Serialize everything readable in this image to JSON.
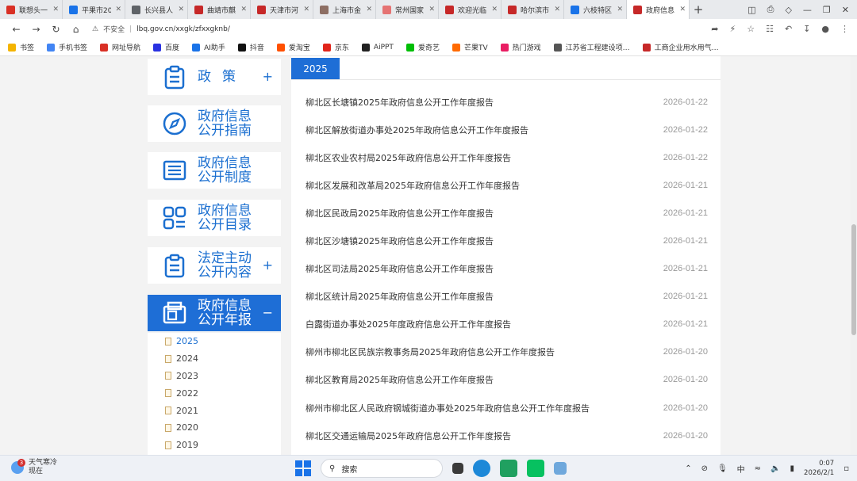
{
  "browser": {
    "tabs": [
      {
        "title": "联想头一…",
        "color": "#d93025"
      },
      {
        "title": "平果市20…",
        "color": "#1a73e8"
      },
      {
        "title": "长兴县人…",
        "color": "#5f6368"
      },
      {
        "title": "曲靖市麒…",
        "color": "#c62828"
      },
      {
        "title": "天津市河…",
        "color": "#c62828"
      },
      {
        "title": "上海市金…",
        "color": "#8d6e63"
      },
      {
        "title": "常州国家…",
        "color": "#e57373"
      },
      {
        "title": "欢迎光临…",
        "color": "#c62828"
      },
      {
        "title": "哈尔滨市…",
        "color": "#c62828"
      },
      {
        "title": "六枝特区…",
        "color": "#1a73e8"
      },
      {
        "title": "政府信息…",
        "color": "#c62828",
        "active": true
      }
    ],
    "new_tab": "+",
    "security_text": "不安全",
    "url": "lbq.gov.cn/xxgk/zfxxgknb/"
  },
  "bookmarks": [
    {
      "label": "书签",
      "color": "#f4b400"
    },
    {
      "label": "手机书签",
      "color": "#4285f4"
    },
    {
      "label": "网址导航",
      "color": "#d93025"
    },
    {
      "label": "百度",
      "color": "#2932e1"
    },
    {
      "label": "AI助手",
      "color": "#1a73e8"
    },
    {
      "label": "抖音",
      "color": "#111111"
    },
    {
      "label": "爱淘宝",
      "color": "#ff5000"
    },
    {
      "label": "京东",
      "color": "#e1251b"
    },
    {
      "label": "AiPPT",
      "color": "#222222"
    },
    {
      "label": "爱奇艺",
      "color": "#00be06"
    },
    {
      "label": "芒果TV",
      "color": "#ff6a00"
    },
    {
      "label": "热门游戏",
      "color": "#e91e63"
    },
    {
      "label": "江苏省工程建设项…",
      "color": "#555555"
    },
    {
      "label": "工商企业用水用气…",
      "color": "#c62828"
    }
  ],
  "sidebar": {
    "items": [
      {
        "label": "政策",
        "plus": "+"
      },
      {
        "label": "政府信息公开指南",
        "plus": ""
      },
      {
        "label": "政府信息公开制度",
        "plus": ""
      },
      {
        "label": "政府信息公开目录",
        "plus": ""
      },
      {
        "label": "法定主动公开内容",
        "plus": "+"
      },
      {
        "label": "政府信息公开年报",
        "plus": "−"
      }
    ],
    "years": [
      "2025",
      "2024",
      "2023",
      "2022",
      "2021",
      "2020",
      "2019"
    ]
  },
  "content": {
    "active_year": "2025",
    "reports": [
      {
        "title": "柳北区长塘镇2025年政府信息公开工作年度报告",
        "date": "2026-01-22"
      },
      {
        "title": "柳北区解放街道办事处2025年政府信息公开工作年度报告",
        "date": "2026-01-22"
      },
      {
        "title": "柳北区农业农村局2025年政府信息公开工作年度报告",
        "date": "2026-01-22"
      },
      {
        "title": "柳北区发展和改革局2025年政府信息公开工作年度报告",
        "date": "2026-01-21"
      },
      {
        "title": "柳北区民政局2025年政府信息公开工作年度报告",
        "date": "2026-01-21"
      },
      {
        "title": "柳北区沙塘镇2025年政府信息公开工作年度报告",
        "date": "2026-01-21"
      },
      {
        "title": "柳北区司法局2025年政府信息公开工作年度报告",
        "date": "2026-01-21"
      },
      {
        "title": "柳北区统计局2025年政府信息公开工作年度报告",
        "date": "2026-01-21"
      },
      {
        "title": "白露街道办事处2025年度政府信息公开工作年度报告",
        "date": "2026-01-21"
      },
      {
        "title": "柳州市柳北区民族宗教事务局2025年政府信息公开工作年度报告",
        "date": "2026-01-20"
      },
      {
        "title": "柳北区教育局2025年政府信息公开工作年度报告",
        "date": "2026-01-20"
      },
      {
        "title": "柳州市柳北区人民政府钢城街道办事处2025年政府信息公开工作年度报告",
        "date": "2026-01-20"
      },
      {
        "title": "柳北区交通运输局2025年政府信息公开工作年度报告",
        "date": "2026-01-20"
      }
    ]
  },
  "taskbar": {
    "weather_badge": "3",
    "weather_line1": "天气寒冷",
    "weather_line2": "现在",
    "search_label": "搜索",
    "ime": "中",
    "time": "0:07",
    "date": "2026/2/1"
  }
}
